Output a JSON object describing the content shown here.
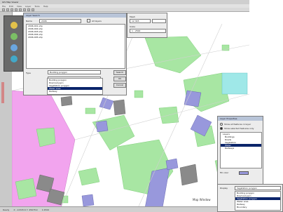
{
  "window": {
    "title": "GIS Map Viewer"
  },
  "menu": [
    "File",
    "Edit",
    "View",
    "Layer",
    "Tools",
    "Help"
  ],
  "main_dialog": {
    "title": "Layer Search",
    "name_label": "Name",
    "name_value": "2006",
    "list_items": [
      "2006-001.shp",
      "2006-002.shp",
      "2006-003.shp",
      "2006-004.shp",
      "2006-005.shp"
    ],
    "checkbox_label": "All layers",
    "field1_label": "Mesh",
    "field1_value": "12 345",
    "field2_label": "Scale",
    "field2_value": "1 : 2500",
    "field3_value": "",
    "field4_value": "",
    "kind_label": "Type",
    "kind_value": "Building polygon",
    "search_button": "Search",
    "dropdown_items": [
      "Building polygon",
      "Road polygon",
      "Vegetation polygon",
      "Water area",
      "Railway"
    ],
    "dropdown_selected_index": 3,
    "ok_button": "OK",
    "cancel_button": "Cancel"
  },
  "side_panel": {
    "icons": [
      "layer-icon",
      "select-icon",
      "zoom-icon",
      "info-icon"
    ]
  },
  "right_dialog": {
    "title": "Layer Properties",
    "radio1": "Show all features in layer",
    "radio2": "Show selected features only",
    "tree_items": [
      "Layers",
      "Buildings",
      "Roads",
      "Vegetation",
      "Water",
      "Railways"
    ],
    "tree_selected_index": 4,
    "color_label": "Fill color",
    "color_value": "#9999dd",
    "ok_button": "OK",
    "cancel_button": "Cancel"
  },
  "bottom_dropdown": {
    "label": "Display",
    "value": "Vegetation polygon",
    "items": [
      "Building polygon",
      "Road polygon",
      "Vegetation polygon",
      "Water area",
      "Railway",
      "Boundary"
    ],
    "selected_index": 2
  },
  "status": {
    "left": "Ready",
    "coords": "X: -12345.6  Y: 45678.9",
    "scale": "1:2500"
  },
  "map_label": "Map Window",
  "colors": {
    "vegetation": "#a8e6a3",
    "vegetation_stroke": "#6cc566",
    "building_blue": "#9898dc",
    "building_gray": "#8a8a8a",
    "district_pink": "#f2a4ee",
    "road": "#ffffff",
    "water": "#9fe8e8",
    "selected": "#0a246a"
  }
}
